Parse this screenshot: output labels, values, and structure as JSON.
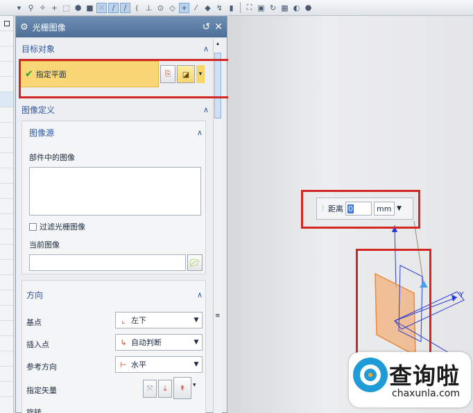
{
  "dialog": {
    "title": "光栅图像",
    "sections": {
      "target": {
        "header": "目标对象",
        "select_label": "指定平面"
      },
      "image_def": {
        "header": "图像定义",
        "source": {
          "header": "图像源",
          "part_images_label": "部件中的图像",
          "filter_label": "过滤光栅图像",
          "current_image_label": "当前图像"
        }
      },
      "direction": {
        "header": "方向",
        "base_point_label": "基点",
        "base_point_value": "左下",
        "insert_point_label": "插入点",
        "insert_point_value": "自动判断",
        "ref_dir_label": "参考方向",
        "ref_dir_value": "水平",
        "vector_label": "指定矢量",
        "cut_label": "旋转"
      }
    }
  },
  "viewport": {
    "distance_label": "距离",
    "distance_value": "0",
    "unit_value": "mm",
    "axis_y": "Y"
  },
  "watermark": {
    "cn": "查询啦",
    "en": "chaxunla.com"
  },
  "colors": {
    "highlight_red": "#d42525",
    "selection_yellow": "#f9d776",
    "plane_orange": "#f2b07c",
    "axis_blue": "#2a3bd6"
  }
}
